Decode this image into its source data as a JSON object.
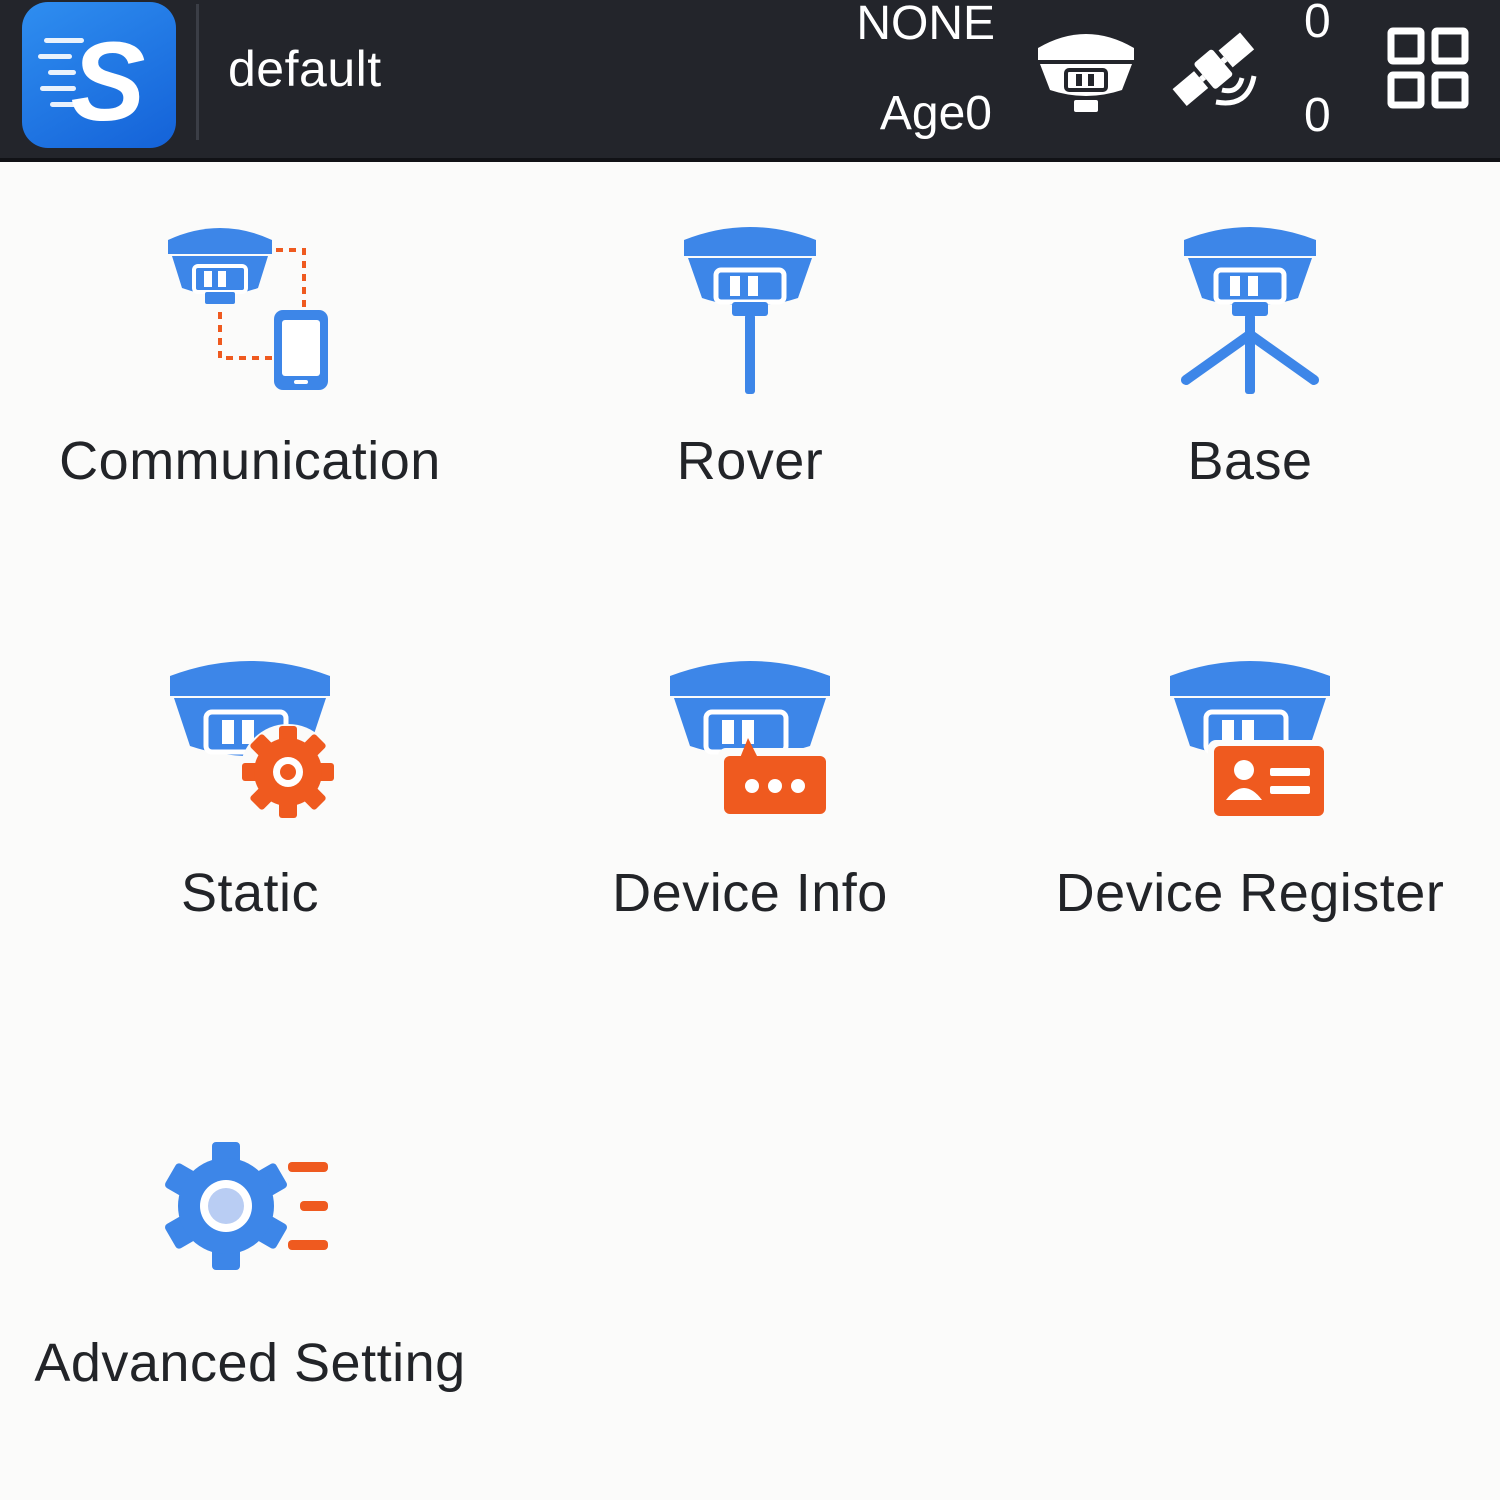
{
  "header": {
    "app_logo_letter": "S",
    "profile_name": "default",
    "solution_status": "NONE",
    "correction_age": "Age0",
    "satellites_used": "0",
    "satellites_tracked": "0",
    "icons": [
      "app-logo",
      "receiver-icon",
      "satellite-icon",
      "grid-menu-icon"
    ]
  },
  "colors": {
    "header_bg": "#23252b",
    "accent_blue": "#3d86e8",
    "accent_orange": "#ef5a1f",
    "background": "#fbfbfa"
  },
  "menu": {
    "items": [
      {
        "label": "Communication",
        "icon": "communication-icon"
      },
      {
        "label": "Rover",
        "icon": "rover-icon"
      },
      {
        "label": "Base",
        "icon": "base-icon"
      },
      {
        "label": "Static",
        "icon": "static-icon"
      },
      {
        "label": "Device Info",
        "icon": "device-info-icon"
      },
      {
        "label": "Device Register",
        "icon": "device-register-icon"
      },
      {
        "label": "Advanced Setting",
        "icon": "advanced-setting-icon"
      }
    ]
  }
}
